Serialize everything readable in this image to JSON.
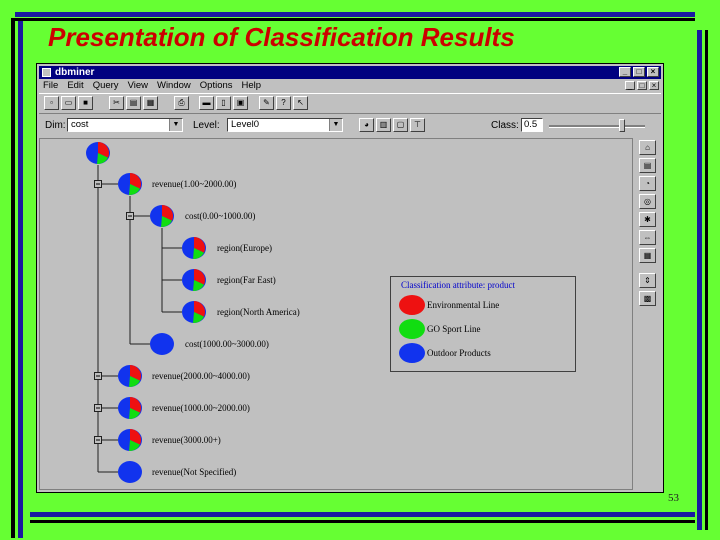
{
  "slide": {
    "title": "Presentation of Classification Results",
    "page_number": "53"
  },
  "window": {
    "title": "dbminer",
    "menu": [
      "File",
      "Edit",
      "Query",
      "View",
      "Window",
      "Options",
      "Help"
    ]
  },
  "dimension_bar": {
    "dim_label": "Dim:",
    "dim_value": "cost",
    "level_label": "Level:",
    "level_value": "Level0",
    "class_label": "Class:",
    "class_value": "0.5"
  },
  "tree": {
    "root": {
      "pie": "mixed"
    },
    "nodes": [
      {
        "label": "revenue(1.00~2000.00)",
        "pie": "mixed"
      },
      {
        "label": "cost(0.00~1000.00)",
        "pie": "mixed"
      },
      {
        "label": "region(Europe)",
        "pie": "mixed"
      },
      {
        "label": "region(Far East)",
        "pie": "mixed"
      },
      {
        "label": "region(North America)",
        "pie": "mixed"
      },
      {
        "label": "cost(1000.00~3000.00)",
        "pie": "blue"
      },
      {
        "label": "revenue(2000.00~4000.00)",
        "pie": "mixed"
      },
      {
        "label": "revenue(1000.00~2000.00)",
        "pie": "mixed"
      },
      {
        "label": "revenue(3000.00+)",
        "pie": "mixed"
      },
      {
        "label": "revenue(Not Specified)",
        "pie": "blue"
      }
    ]
  },
  "legend": {
    "title": "Classification attribute: product",
    "items": [
      {
        "label": "Environmental Line",
        "color": "#ee1111"
      },
      {
        "label": "GO Sport Line",
        "color": "#11dd11"
      },
      {
        "label": "Outdoor Products",
        "color": "#1133ee"
      }
    ]
  },
  "colors": {
    "slide_background": "#66ff33",
    "title_text": "#cc0000",
    "border_blue": "#1a1aa0",
    "window_gray": "#c0c0c0",
    "titlebar": "#000080"
  }
}
